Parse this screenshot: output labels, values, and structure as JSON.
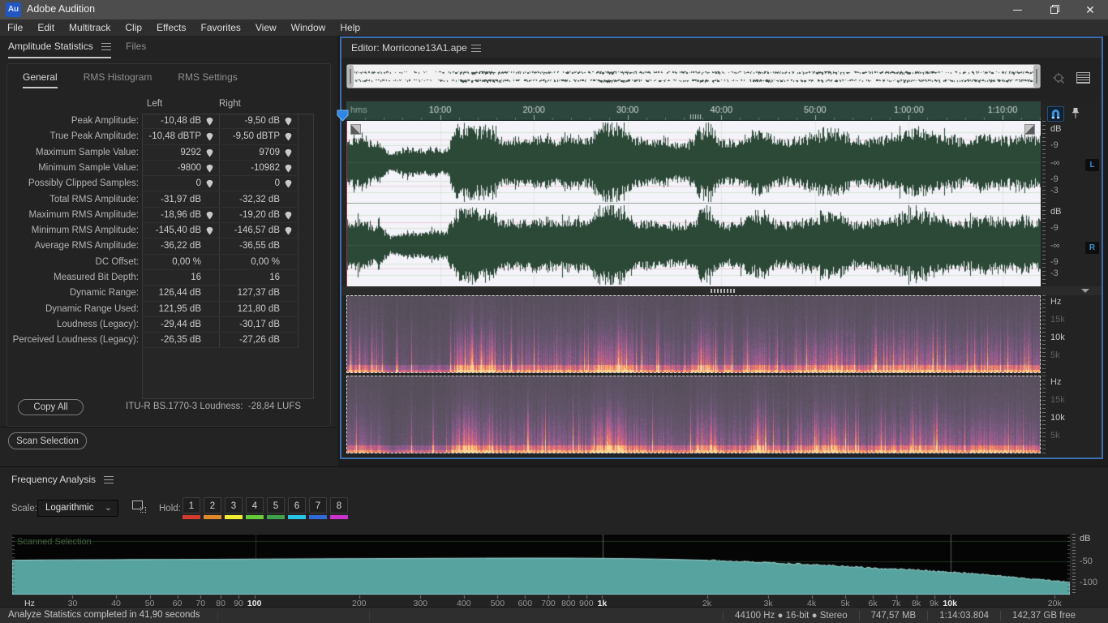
{
  "window": {
    "logo": "Au",
    "title": "Adobe Audition"
  },
  "menu": {
    "items": [
      "File",
      "Edit",
      "Multitrack",
      "Clip",
      "Effects",
      "Favorites",
      "View",
      "Window",
      "Help"
    ]
  },
  "stats_panel": {
    "tabs": [
      {
        "label": "Amplitude Statistics",
        "active": true
      },
      {
        "label": "Files",
        "active": false
      }
    ],
    "subtabs": [
      {
        "label": "General",
        "active": true
      },
      {
        "label": "RMS Histogram",
        "active": false
      },
      {
        "label": "RMS Settings",
        "active": false
      }
    ],
    "columns": [
      "Left",
      "Right"
    ],
    "rows": [
      {
        "label": "Peak Amplitude:",
        "left": "-10,48 dB",
        "right": "-9,50 dB",
        "marker": true
      },
      {
        "label": "True Peak Amplitude:",
        "left": "-10,48 dBTP",
        "right": "-9,50 dBTP",
        "marker": true
      },
      {
        "label": "Maximum Sample Value:",
        "left": "9292",
        "right": "9709",
        "marker": true
      },
      {
        "label": "Minimum Sample Value:",
        "left": "-9800",
        "right": "-10982",
        "marker": true
      },
      {
        "label": "Possibly Clipped Samples:",
        "left": "0",
        "right": "0",
        "marker": true
      },
      {
        "label": "Total RMS Amplitude:",
        "left": "-31,97 dB",
        "right": "-32,32 dB",
        "marker": false
      },
      {
        "label": "Maximum RMS Amplitude:",
        "left": "-18,96 dB",
        "right": "-19,20 dB",
        "marker": true
      },
      {
        "label": "Minimum RMS Amplitude:",
        "left": "-145,40 dB",
        "right": "-146,57 dB",
        "marker": true
      },
      {
        "label": "Average RMS Amplitude:",
        "left": "-36,22 dB",
        "right": "-36,55 dB",
        "marker": false
      },
      {
        "label": "DC Offset:",
        "left": "0,00 %",
        "right": "0,00 %",
        "marker": false
      },
      {
        "label": "Measured Bit Depth:",
        "left": "16",
        "right": "16",
        "marker": false
      },
      {
        "label": "Dynamic Range:",
        "left": "126,44 dB",
        "right": "127,37 dB",
        "marker": false
      },
      {
        "label": "Dynamic Range Used:",
        "left": "121,95 dB",
        "right": "121,80 dB",
        "marker": false
      },
      {
        "label": "Loudness (Legacy):",
        "left": "-29,44 dB",
        "right": "-30,17 dB",
        "marker": false
      },
      {
        "label": "Perceived Loudness (Legacy):",
        "left": "-26,35 dB",
        "right": "-27,26 dB",
        "marker": false
      }
    ],
    "copy_all_label": "Copy All",
    "loudness_summary": "ITU-R BS.1770-3 Loudness:  -28,84 LUFS",
    "scan_selection_label": "Scan Selection"
  },
  "editor": {
    "title": "Editor: Morricone13A1.ape",
    "ruler_unit": "hms",
    "time_labels": [
      "10:00",
      "20:00",
      "30:00",
      "40:00",
      "50:00",
      "1:00:00",
      "1:10:00"
    ],
    "db_scale": [
      "dB",
      "-9",
      "-∞",
      "-9",
      "-3"
    ],
    "hz_scale": [
      {
        "label": "Hz",
        "dim": false
      },
      {
        "label": "15k",
        "dim": true
      },
      {
        "label": "10k",
        "dim": false
      },
      {
        "label": "5k",
        "dim": true
      }
    ],
    "channel_badges": [
      "L",
      "R"
    ]
  },
  "waveform": {
    "color": "#2c4837",
    "background": "#f3f3f9",
    "envelope": [
      0.3,
      0.33,
      0.28,
      0.26,
      0.1,
      0.16,
      0.18,
      0.15,
      0.2,
      0.16,
      0.45,
      0.48,
      0.44,
      0.47,
      0.3,
      0.33,
      0.3,
      0.32,
      0.34,
      0.31,
      0.33,
      0.35,
      0.3,
      0.5,
      0.52,
      0.48,
      0.36,
      0.3,
      0.28,
      0.3,
      0.26,
      0.24,
      0.44,
      0.47,
      0.3,
      0.28,
      0.32,
      0.4,
      0.42,
      0.3,
      0.28,
      0.33,
      0.36,
      0.4,
      0.44,
      0.4,
      0.3,
      0.28,
      0.34,
      0.32,
      0.36,
      0.42,
      0.44,
      0.4,
      0.36,
      0.33,
      0.3,
      0.34,
      0.37,
      0.35,
      0.32,
      0.36,
      0.34,
      0.3
    ]
  },
  "freq_panel": {
    "title": "Frequency Analysis",
    "scale_label": "Scale:",
    "scale_value": "Logarithmic",
    "hold_label": "Hold:",
    "hold_buttons": [
      {
        "n": "1",
        "color": "#d23b2e"
      },
      {
        "n": "2",
        "color": "#e0882c"
      },
      {
        "n": "3",
        "color": "#f0ee33"
      },
      {
        "n": "4",
        "color": "#63cc37"
      },
      {
        "n": "5",
        "color": "#3fa24c"
      },
      {
        "n": "6",
        "color": "#2bc5e8"
      },
      {
        "n": "7",
        "color": "#2e6bd8"
      },
      {
        "n": "8",
        "color": "#cc33cc"
      }
    ]
  },
  "chart_data": {
    "type": "area",
    "title": "Scanned Selection",
    "xlabel": "Hz",
    "ylabel": "dB",
    "x_scale": "log",
    "x_range": [
      20,
      22000
    ],
    "y_range": [
      15,
      -130
    ],
    "y_ticks": [
      "dB",
      "-50",
      "-100"
    ],
    "y_tick_values": [
      0,
      -50,
      -100
    ],
    "x_ticks": [
      {
        "f": 30,
        "label": "30"
      },
      {
        "f": 40,
        "label": "40"
      },
      {
        "f": 50,
        "label": "50"
      },
      {
        "f": 60,
        "label": "60"
      },
      {
        "f": 70,
        "label": "70"
      },
      {
        "f": 80,
        "label": "80"
      },
      {
        "f": 90,
        "label": "90"
      },
      {
        "f": 100,
        "label": "100",
        "bold": true
      },
      {
        "f": 200,
        "label": "200"
      },
      {
        "f": 300,
        "label": "300"
      },
      {
        "f": 400,
        "label": "400"
      },
      {
        "f": 500,
        "label": "500"
      },
      {
        "f": 600,
        "label": "600"
      },
      {
        "f": 700,
        "label": "700"
      },
      {
        "f": 800,
        "label": "800"
      },
      {
        "f": 900,
        "label": "900"
      },
      {
        "f": 1000,
        "label": "1k",
        "bold": true
      },
      {
        "f": 2000,
        "label": "2k"
      },
      {
        "f": 3000,
        "label": "3k"
      },
      {
        "f": 4000,
        "label": "4k"
      },
      {
        "f": 5000,
        "label": "5k"
      },
      {
        "f": 6000,
        "label": "6k"
      },
      {
        "f": 7000,
        "label": "7k"
      },
      {
        "f": 8000,
        "label": "8k"
      },
      {
        "f": 9000,
        "label": "9k"
      },
      {
        "f": 10000,
        "label": "10k",
        "bold": true
      },
      {
        "f": 20000,
        "label": "20k"
      }
    ],
    "series": [
      {
        "name": "Scanned Selection",
        "color": "#57a3a0",
        "edge_color": "#a5ded9",
        "points": [
          [
            20,
            -47
          ],
          [
            25,
            -46.3
          ],
          [
            30,
            -46
          ],
          [
            40,
            -45.6
          ],
          [
            50,
            -45.2
          ],
          [
            60,
            -45
          ],
          [
            80,
            -44.6
          ],
          [
            100,
            -44.2
          ],
          [
            150,
            -43.6
          ],
          [
            200,
            -43.2
          ],
          [
            300,
            -42.6
          ],
          [
            400,
            -42.2
          ],
          [
            500,
            -42
          ],
          [
            600,
            -41.8
          ],
          [
            700,
            -41.9
          ],
          [
            800,
            -42
          ],
          [
            900,
            -42.2
          ],
          [
            1000,
            -42.5
          ],
          [
            1200,
            -43.2
          ],
          [
            1500,
            -44.5
          ],
          [
            2000,
            -47
          ],
          [
            2500,
            -50
          ],
          [
            3000,
            -53
          ],
          [
            4000,
            -58
          ],
          [
            5000,
            -62
          ],
          [
            6000,
            -65.5
          ],
          [
            7000,
            -68.5
          ],
          [
            8000,
            -71
          ],
          [
            9000,
            -73.5
          ],
          [
            10000,
            -76
          ],
          [
            12000,
            -81
          ],
          [
            14000,
            -86
          ],
          [
            16000,
            -90
          ],
          [
            18000,
            -94
          ],
          [
            20000,
            -97
          ],
          [
            21500,
            -100
          ]
        ]
      }
    ],
    "grid": {
      "h_db": [
        0,
        -50,
        -100
      ],
      "v_green_hz": [
        100
      ],
      "v_gray_hz": [
        1000,
        10000
      ]
    }
  },
  "status_bar": {
    "left": "Analyze Statistics completed in 41,90 seconds",
    "items": [
      "44100 Hz ● 16-bit ● Stereo",
      "747,57 MB",
      "1:14:03.804",
      "142,37 GB free"
    ]
  }
}
